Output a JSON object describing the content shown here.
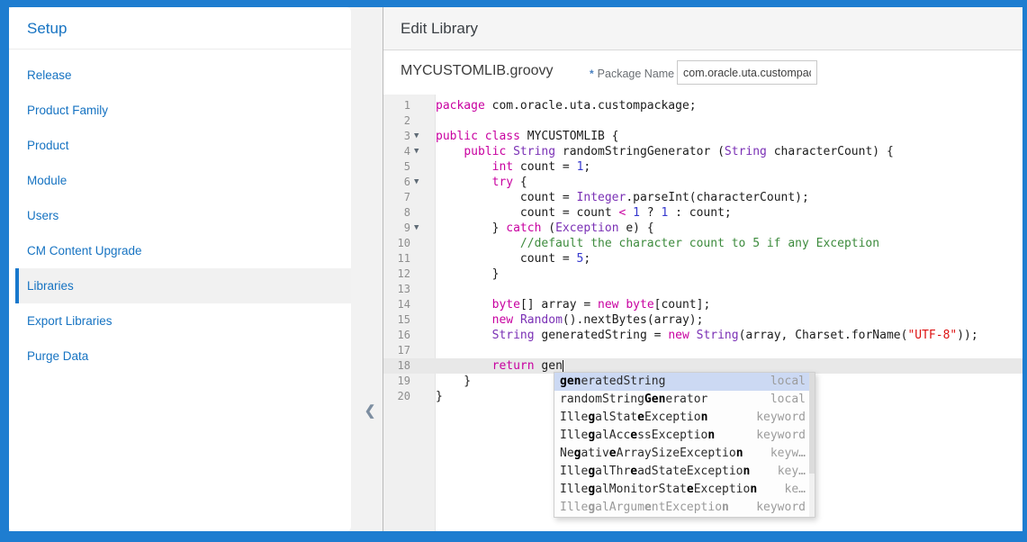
{
  "frame": {
    "color": "#1e7dd0"
  },
  "sidebar": {
    "title": "Setup",
    "items": [
      {
        "label": "Release",
        "selected": false
      },
      {
        "label": "Product Family",
        "selected": false
      },
      {
        "label": "Product",
        "selected": false
      },
      {
        "label": "Module",
        "selected": false
      },
      {
        "label": "Users",
        "selected": false
      },
      {
        "label": "CM Content Upgrade",
        "selected": false
      },
      {
        "label": "Libraries",
        "selected": true
      },
      {
        "label": "Export Libraries",
        "selected": false
      },
      {
        "label": "Purge Data",
        "selected": false
      }
    ],
    "collapse_icon": "❮"
  },
  "main": {
    "header_title": "Edit Library",
    "file_name": "MYCUSTOMLIB.groovy",
    "package_field": {
      "required_mark": "*",
      "label": "Package Name",
      "value": "com.oracle.uta.custompack"
    }
  },
  "editor": {
    "syntax_colors": {
      "keyword": "#c800a0",
      "type": "#7a30b5",
      "number": "#3538ce",
      "string": "#dd1111",
      "comment": "#3d8b3d",
      "default": "#1c1c1c"
    },
    "lines": [
      {
        "n": 1,
        "fold": false,
        "active": false,
        "tokens": [
          [
            "kw",
            "package"
          ],
          [
            "pl",
            " com.oracle.uta.custompackage;"
          ]
        ]
      },
      {
        "n": 2,
        "fold": false,
        "active": false,
        "tokens": []
      },
      {
        "n": 3,
        "fold": true,
        "active": false,
        "tokens": [
          [
            "kw",
            "public"
          ],
          [
            "pl",
            " "
          ],
          [
            "kw",
            "class"
          ],
          [
            "pl",
            " MYCUSTOMLIB {"
          ]
        ]
      },
      {
        "n": 4,
        "fold": true,
        "active": false,
        "tokens": [
          [
            "pl",
            "    "
          ],
          [
            "kw",
            "public"
          ],
          [
            "pl",
            " "
          ],
          [
            "ty",
            "String"
          ],
          [
            "pl",
            " randomStringGenerator ("
          ],
          [
            "ty",
            "String"
          ],
          [
            "pl",
            " characterCount) {"
          ]
        ]
      },
      {
        "n": 5,
        "fold": false,
        "active": false,
        "tokens": [
          [
            "pl",
            "        "
          ],
          [
            "kw",
            "int"
          ],
          [
            "pl",
            " count = "
          ],
          [
            "nu",
            "1"
          ],
          [
            "pl",
            ";"
          ]
        ]
      },
      {
        "n": 6,
        "fold": true,
        "active": false,
        "tokens": [
          [
            "pl",
            "        "
          ],
          [
            "kw",
            "try"
          ],
          [
            "pl",
            " {"
          ]
        ]
      },
      {
        "n": 7,
        "fold": false,
        "active": false,
        "tokens": [
          [
            "pl",
            "            count = "
          ],
          [
            "ty",
            "Integer"
          ],
          [
            "pl",
            ".parseInt(characterCount);"
          ]
        ]
      },
      {
        "n": 8,
        "fold": false,
        "active": false,
        "tokens": [
          [
            "pl",
            "            count = count "
          ],
          [
            "kw",
            "<"
          ],
          [
            "pl",
            " "
          ],
          [
            "nu",
            "1"
          ],
          [
            "pl",
            " ? "
          ],
          [
            "nu",
            "1"
          ],
          [
            "pl",
            " : count;"
          ]
        ]
      },
      {
        "n": 9,
        "fold": true,
        "active": false,
        "tokens": [
          [
            "pl",
            "        } "
          ],
          [
            "kw",
            "catch"
          ],
          [
            "pl",
            " ("
          ],
          [
            "ty",
            "Exception"
          ],
          [
            "pl",
            " e) {"
          ]
        ]
      },
      {
        "n": 10,
        "fold": false,
        "active": false,
        "tokens": [
          [
            "pl",
            "            "
          ],
          [
            "co",
            "//default the character count to 5 if any Exception"
          ]
        ]
      },
      {
        "n": 11,
        "fold": false,
        "active": false,
        "tokens": [
          [
            "pl",
            "            count = "
          ],
          [
            "nu",
            "5"
          ],
          [
            "pl",
            ";"
          ]
        ]
      },
      {
        "n": 12,
        "fold": false,
        "active": false,
        "tokens": [
          [
            "pl",
            "        }"
          ]
        ]
      },
      {
        "n": 13,
        "fold": false,
        "active": false,
        "tokens": []
      },
      {
        "n": 14,
        "fold": false,
        "active": false,
        "tokens": [
          [
            "pl",
            "        "
          ],
          [
            "kw",
            "byte"
          ],
          [
            "pl",
            "[] array = "
          ],
          [
            "kw",
            "new"
          ],
          [
            "pl",
            " "
          ],
          [
            "kw",
            "byte"
          ],
          [
            "pl",
            "[count];"
          ]
        ]
      },
      {
        "n": 15,
        "fold": false,
        "active": false,
        "tokens": [
          [
            "pl",
            "        "
          ],
          [
            "kw",
            "new"
          ],
          [
            "pl",
            " "
          ],
          [
            "ty",
            "Random"
          ],
          [
            "pl",
            "().nextBytes(array);"
          ]
        ]
      },
      {
        "n": 16,
        "fold": false,
        "active": false,
        "tokens": [
          [
            "pl",
            "        "
          ],
          [
            "ty",
            "String"
          ],
          [
            "pl",
            " generatedString = "
          ],
          [
            "kw",
            "new"
          ],
          [
            "pl",
            " "
          ],
          [
            "ty",
            "String"
          ],
          [
            "pl",
            "(array, Charset.forName("
          ],
          [
            "st",
            "\"UTF-8\""
          ],
          [
            "pl",
            "));"
          ]
        ]
      },
      {
        "n": 17,
        "fold": false,
        "active": false,
        "tokens": []
      },
      {
        "n": 18,
        "fold": false,
        "active": true,
        "cursor": true,
        "tokens": [
          [
            "pl",
            "        "
          ],
          [
            "kw",
            "return"
          ],
          [
            "pl",
            " gen"
          ]
        ]
      },
      {
        "n": 19,
        "fold": false,
        "active": false,
        "tokens": [
          [
            "pl",
            "    }"
          ]
        ]
      },
      {
        "n": 20,
        "fold": false,
        "active": false,
        "tokens": [
          [
            "pl",
            "}"
          ]
        ]
      }
    ]
  },
  "autocomplete": {
    "items": [
      {
        "parts": [
          [
            "gen",
            1
          ],
          [
            "eratedString",
            0
          ]
        ],
        "meta": "local",
        "selected": true,
        "dim": false
      },
      {
        "parts": [
          [
            "randomString",
            0
          ],
          [
            "Gen",
            1
          ],
          [
            "erator",
            0
          ]
        ],
        "meta": "local",
        "selected": false,
        "dim": false
      },
      {
        "parts": [
          [
            "Ille",
            0
          ],
          [
            "g",
            1
          ],
          [
            "alStat",
            0
          ],
          [
            "e",
            1
          ],
          [
            "Exceptio",
            0
          ],
          [
            "n",
            1
          ]
        ],
        "meta": "keyword",
        "selected": false,
        "dim": false
      },
      {
        "parts": [
          [
            "Ille",
            0
          ],
          [
            "g",
            1
          ],
          [
            "alAcc",
            0
          ],
          [
            "e",
            1
          ],
          [
            "ssExceptio",
            0
          ],
          [
            "n",
            1
          ]
        ],
        "meta": "keyword",
        "selected": false,
        "dim": false
      },
      {
        "parts": [
          [
            "Ne",
            0
          ],
          [
            "g",
            1
          ],
          [
            "ativ",
            0
          ],
          [
            "e",
            1
          ],
          [
            "ArraySizeExceptio",
            0
          ],
          [
            "n",
            1
          ]
        ],
        "meta": "keyw…",
        "selected": false,
        "dim": false
      },
      {
        "parts": [
          [
            "Ille",
            0
          ],
          [
            "g",
            1
          ],
          [
            "alThr",
            0
          ],
          [
            "e",
            1
          ],
          [
            "adStateExceptio",
            0
          ],
          [
            "n",
            1
          ]
        ],
        "meta": "key…",
        "selected": false,
        "dim": false
      },
      {
        "parts": [
          [
            "Ille",
            0
          ],
          [
            "g",
            1
          ],
          [
            "alMonitorStat",
            0
          ],
          [
            "e",
            1
          ],
          [
            "Exceptio",
            0
          ],
          [
            "n",
            1
          ]
        ],
        "meta": "ke…",
        "selected": false,
        "dim": false
      },
      {
        "parts": [
          [
            "Ille",
            0
          ],
          [
            "g",
            1
          ],
          [
            "alArgum",
            0
          ],
          [
            "e",
            1
          ],
          [
            "ntExceptio",
            0
          ],
          [
            "n",
            1
          ]
        ],
        "meta": "keyword",
        "selected": false,
        "dim": true
      }
    ]
  }
}
